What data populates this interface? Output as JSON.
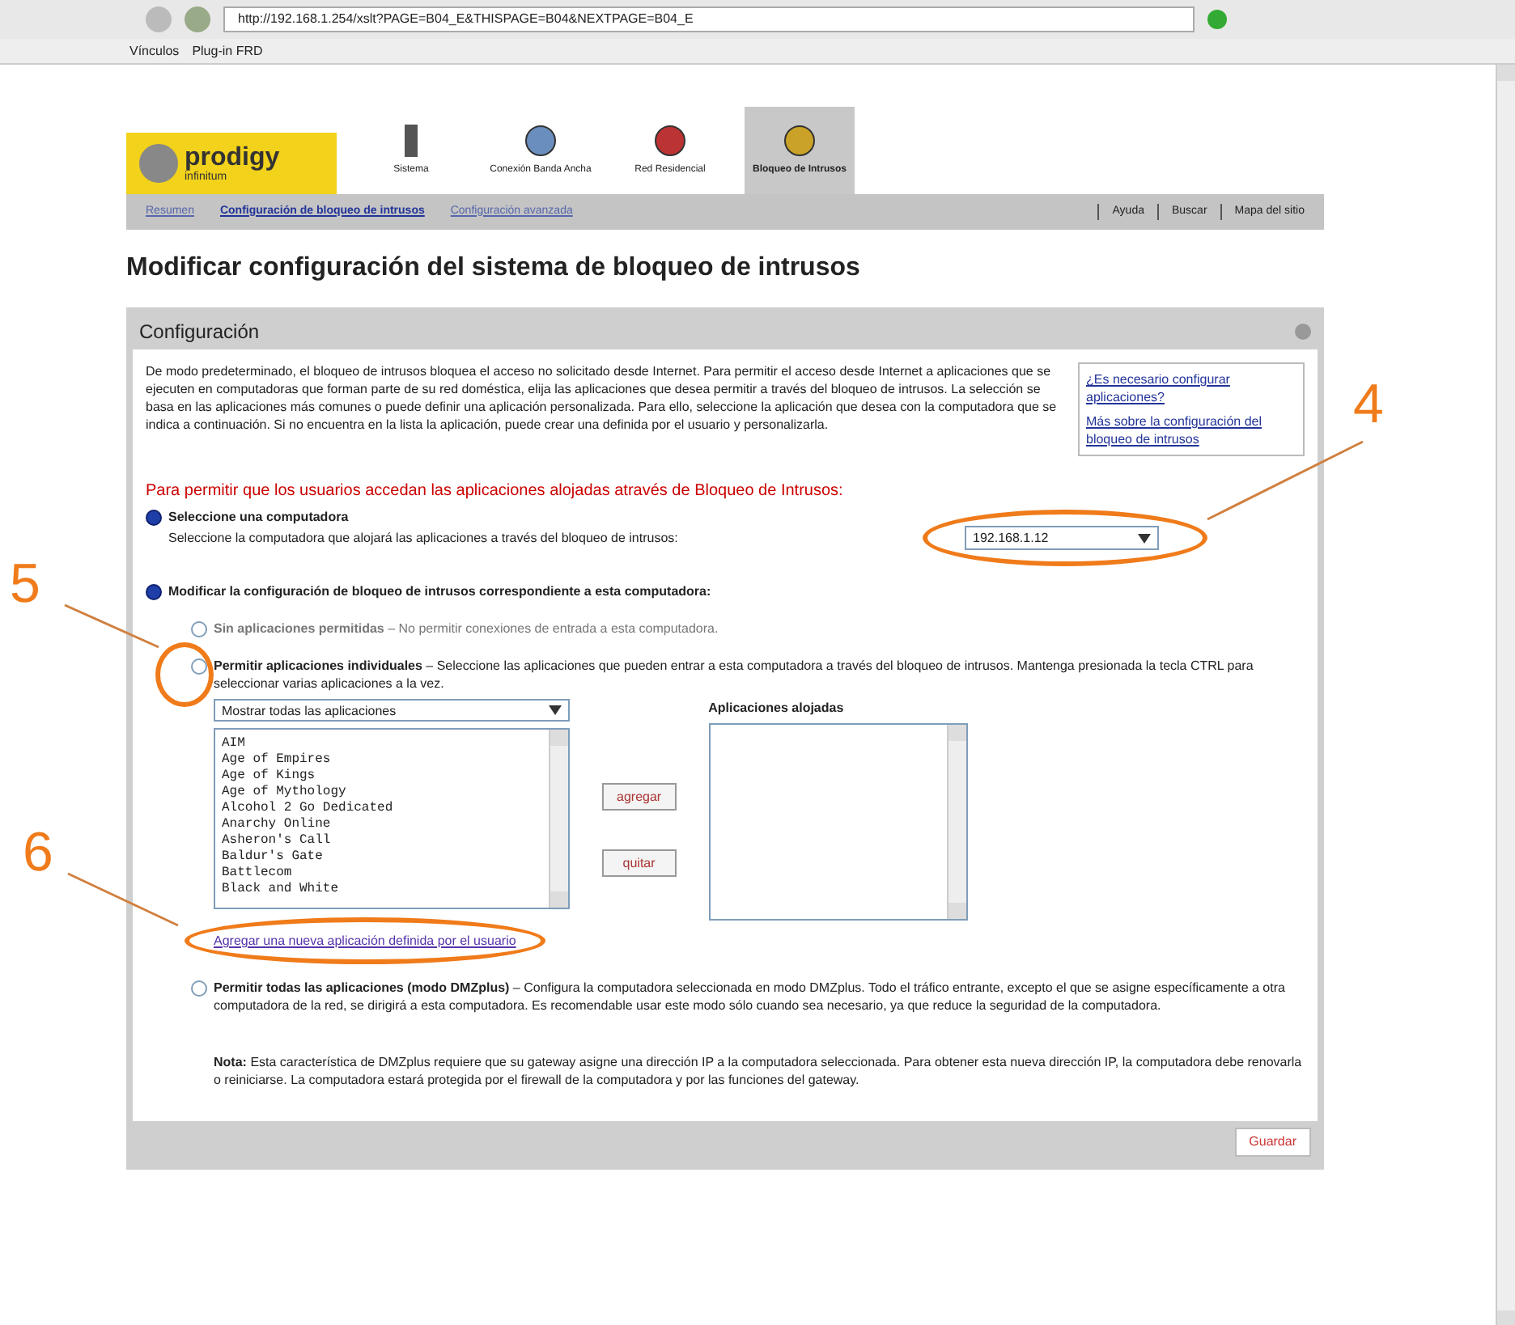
{
  "browser": {
    "address": "http://192.168.1.254/xslt?PAGE=B04_E&THISPAGE=B04&NEXTPAGE=B04_E",
    "links_label": "Vínculos",
    "links": [
      "Plug-in FRD"
    ]
  },
  "logo": {
    "line1": "prodigy",
    "line2": "infinitum"
  },
  "tabs": [
    {
      "label": "Sistema",
      "selected": false
    },
    {
      "label": "Conexión Banda Ancha",
      "selected": false
    },
    {
      "label": "Red Residencial",
      "selected": false
    },
    {
      "label": "Bloqueo de Intrusos",
      "selected": true
    }
  ],
  "breadcrumb": [
    {
      "label": "Resumen",
      "selected": false
    },
    {
      "label": "Configuración de bloqueo de intrusos",
      "selected": true
    },
    {
      "label": "Configuración avanzada",
      "selected": false
    }
  ],
  "utility_links": [
    "Ayuda",
    "Buscar",
    "Mapa del sitio"
  ],
  "title": "Modificar configuración del sistema de bloqueo de intrusos",
  "panel": {
    "title": "Configuración",
    "intro": "De modo predeterminado, el bloqueo de intrusos bloquea el acceso no solicitado desde Internet. Para permitir el acceso desde Internet a aplicaciones que se ejecuten en computadoras que forman parte de su red doméstica, elija las aplicaciones que desea permitir a través del bloqueo de intrusos. La selección se basa en las aplicaciones más comunes o puede definir una aplicación personalizada. Para ello, seleccione la aplicación que desea con la computadora que se indica a continuación. Si no encuentra en la lista la aplicación, puede crear una definida por el usuario y personalizarla.",
    "help_links": [
      "¿Es necesario configurar aplicaciones?",
      "Más sobre la configuración del bloqueo de intrusos"
    ],
    "instruction": "Para permitir que los usuarios accedan las aplicaciones alojadas através de Bloqueo de Intrusos:",
    "step1": {
      "selected": true,
      "label": "Seleccione una computadora",
      "hint": "Seleccione la computadora que alojará las aplicaciones a través del bloqueo de intrusos:",
      "computer": "192.168.1.12"
    },
    "step2": {
      "selected": true,
      "label": "Modificar la configuración de bloqueo de intrusos correspondiente a esta computadora:"
    },
    "options": [
      {
        "kind": "plain",
        "selected": false,
        "title": "Sin aplicaciones permitidas",
        "text": " – No permitir conexiones de entrada a esta computadora."
      },
      {
        "kind": "apps",
        "selected": false,
        "title": "Permitir aplicaciones individuales",
        "text": " – Seleccione las aplicaciones que pueden entrar a esta computadora a través del bloqueo de intrusos. Mantenga presionada la tecla CTRL para seleccionar varias aplicaciones a la vez."
      },
      {
        "kind": "dmz",
        "selected": false,
        "title": "Permitir todas las aplicaciones (modo DMZplus)",
        "text": " – Configura la computadora seleccionada en modo DMZplus. Todo el tráfico entrante, excepto el que se asigne específicamente a otra computadora de la red, se dirigirá a esta computadora. Es recomendable usar este modo sólo cuando sea necesario, ya que reduce la seguridad de la computadora."
      }
    ],
    "filter": "Mostrar todas las aplicaciones",
    "applications": [
      "AIM",
      "Age of Empires",
      "Age of Kings",
      "Age of Mythology",
      "Alcohol 2 Go Dedicated",
      "Anarchy Online",
      "Asheron's Call",
      "Baldur's Gate",
      "Battlecom",
      "Black and White"
    ],
    "add_button": "agregar",
    "remove_button": "quitar",
    "hosted_label": "Aplicaciones alojadas",
    "new_app_link": "Agregar una nueva aplicación definida por el usuario",
    "note_label": "Nota:",
    "note": "Esta característica de DMZplus requiere que su gateway asigne una dirección IP a la computadora seleccionada. Para obtener esta nueva dirección IP, la computadora debe renovarla o reiniciarse. La computadora estará protegida por el firewall de la computadora y por las funciones del gateway.",
    "save_button": "Guardar"
  },
  "annotations": [
    {
      "label": "4"
    },
    {
      "label": "5"
    },
    {
      "label": "6"
    }
  ]
}
